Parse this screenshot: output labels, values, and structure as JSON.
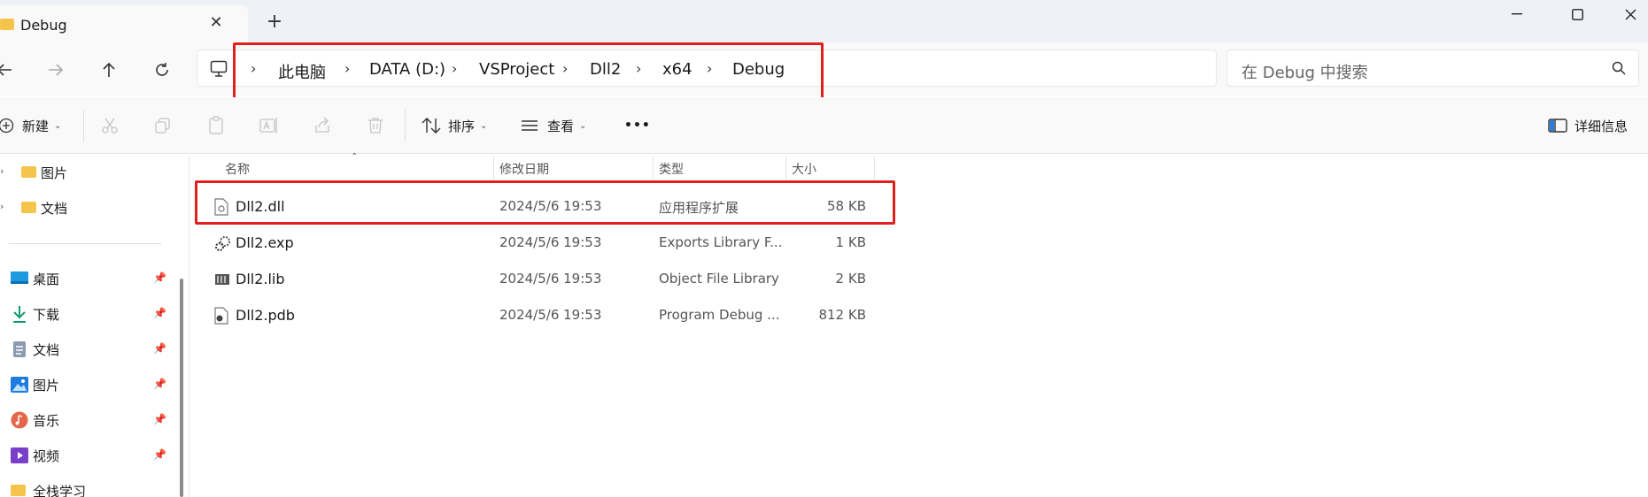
{
  "window": {
    "tab_title": "Debug",
    "new_tab": "+",
    "close_tab": "✕"
  },
  "address": {
    "crumbs": [
      "此电脑",
      "DATA (D:)",
      "VSProject",
      "Dll2",
      "x64",
      "Debug"
    ],
    "separator": "›",
    "search_placeholder": "在 Debug 中搜索"
  },
  "toolbar": {
    "new_label": "新建",
    "sort_label": "排序",
    "view_label": "查看",
    "more_label": "•••",
    "details_label": "详细信息"
  },
  "sidebar": {
    "tree_items": [
      {
        "label": "图片",
        "icon": "folder-icon"
      },
      {
        "label": "文档",
        "icon": "folder-icon"
      }
    ],
    "quick_access": [
      {
        "label": "桌面",
        "icon": "desktop-icon",
        "pinned": true
      },
      {
        "label": "下载",
        "icon": "download-icon",
        "pinned": true
      },
      {
        "label": "文档",
        "icon": "document-icon",
        "pinned": true
      },
      {
        "label": "图片",
        "icon": "picture-icon",
        "pinned": true
      },
      {
        "label": "音乐",
        "icon": "music-icon",
        "pinned": true
      },
      {
        "label": "视频",
        "icon": "video-icon",
        "pinned": true
      },
      {
        "label": "全栈学习",
        "icon": "folder-icon",
        "pinned": false
      }
    ]
  },
  "file_list": {
    "columns": [
      "名称",
      "修改日期",
      "类型",
      "大小"
    ],
    "rows": [
      {
        "name": "Dll2.dll",
        "date": "2024/5/6 19:53",
        "type": "应用程序扩展",
        "size": "58 KB",
        "icon": "dll-file-icon"
      },
      {
        "name": "Dll2.exp",
        "date": "2024/5/6 19:53",
        "type": "Exports Library F...",
        "size": "1 KB",
        "icon": "exp-file-icon"
      },
      {
        "name": "Dll2.lib",
        "date": "2024/5/6 19:53",
        "type": "Object File Library",
        "size": "2 KB",
        "icon": "lib-file-icon"
      },
      {
        "name": "Dll2.pdb",
        "date": "2024/5/6 19:53",
        "type": "Program Debug ...",
        "size": "812 KB",
        "icon": "pdb-file-icon"
      }
    ]
  },
  "colors": {
    "highlight_box": "#e0201f",
    "folder": "#f5c54b"
  }
}
